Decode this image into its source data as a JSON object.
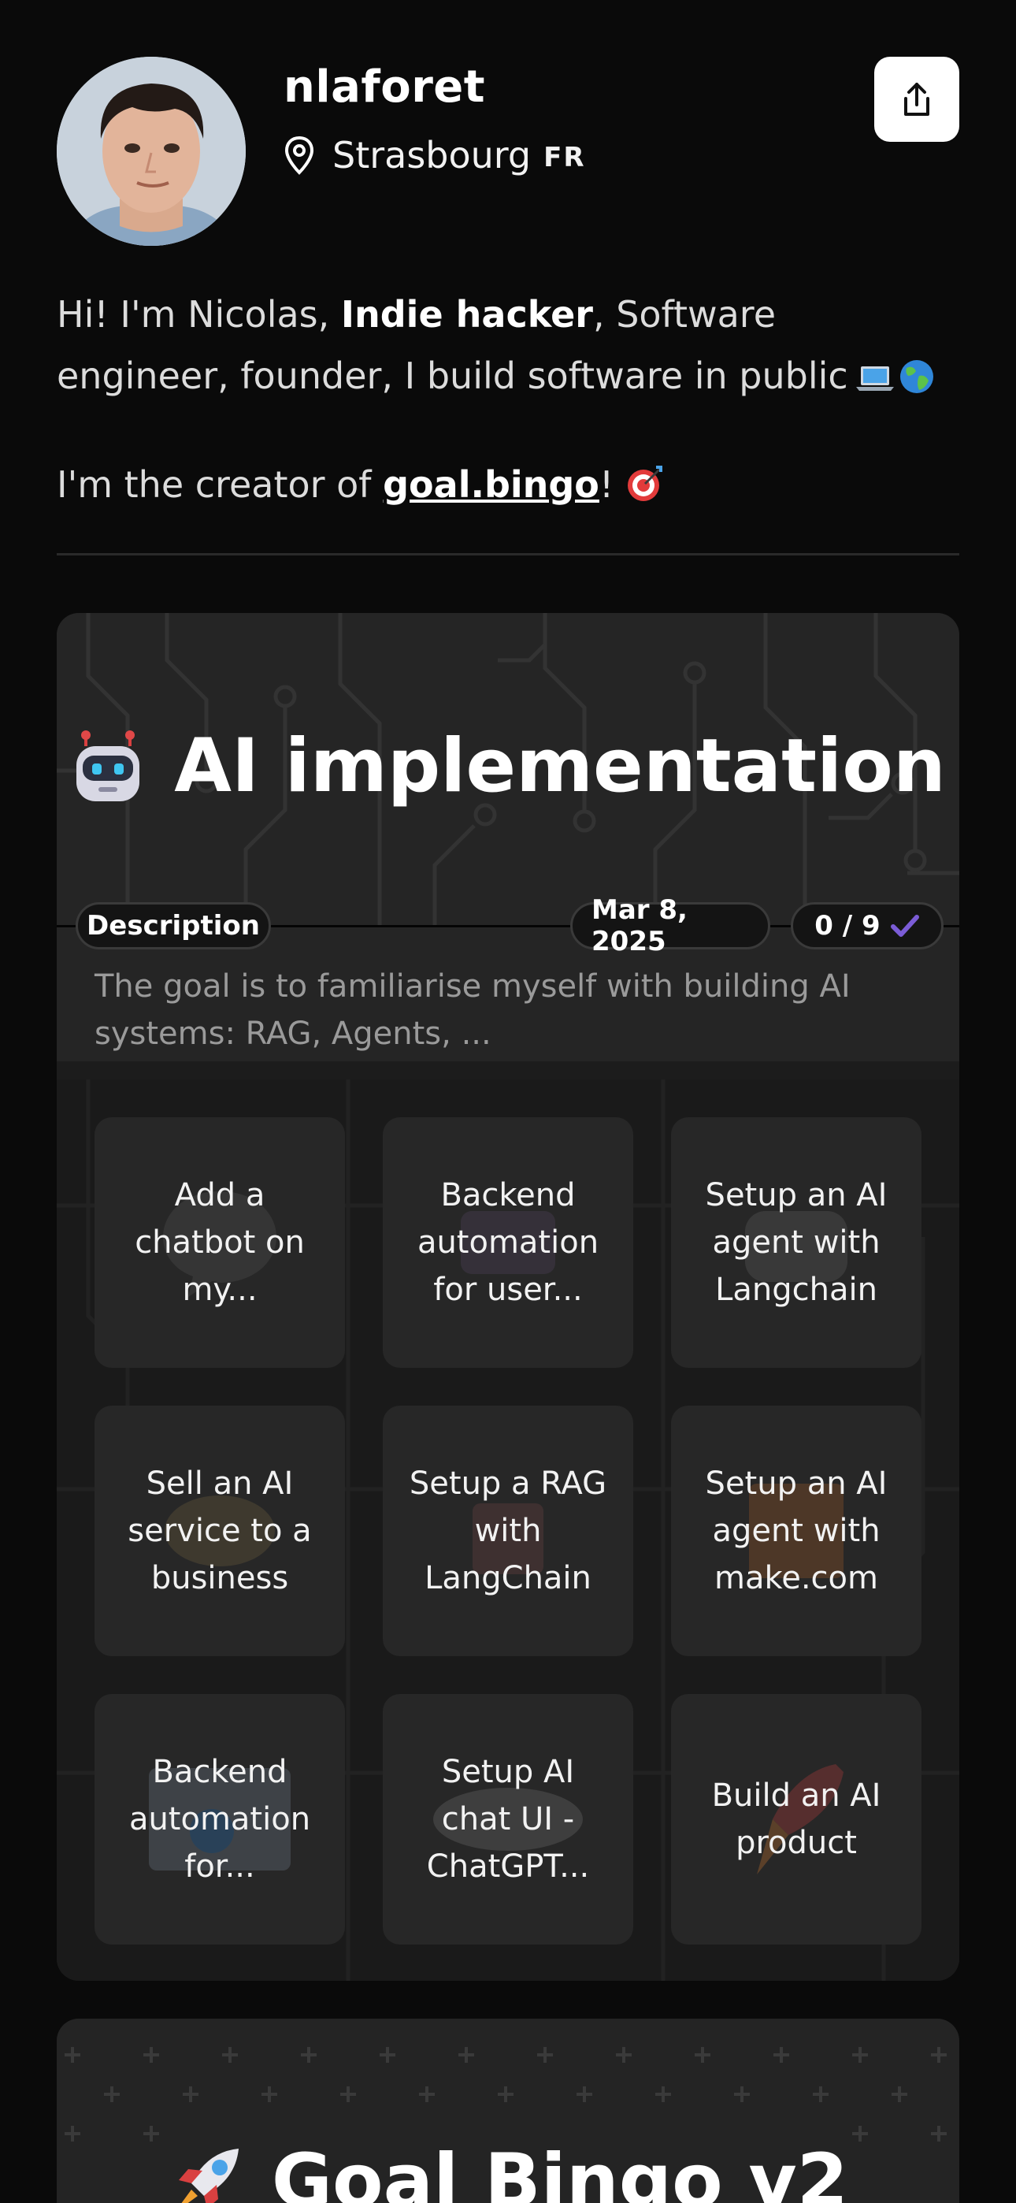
{
  "profile": {
    "username": "nlaforet",
    "city": "Strasbourg",
    "country": "FR"
  },
  "bio": {
    "line1_a": "Hi! I'm Nicolas, ",
    "line1_bold": "Indie hacker",
    "line1_b": ", Software engineer, founder, I build software in public",
    "line2_a": "I'm the creator of ",
    "line2_link": "goal.bingo",
    "line2_b": "!"
  },
  "cards": [
    {
      "title": "AI implementation",
      "description_label": "Description",
      "date": "Mar 8, 2025",
      "progress": "0 / 9",
      "description": "The goal is to familiarise myself with building AI systems: RAG, Agents, ...",
      "tiles": [
        "Add a chatbot on my...",
        "Backend automation for user...",
        "Setup an AI agent with Langchain",
        "Sell an AI service to a business",
        "Setup a RAG with LangChain",
        "Setup an AI agent with make.com",
        "Backend automation for...",
        "Setup AI chat UI - ChatGPT...",
        "Build an AI product"
      ]
    },
    {
      "title": "Goal Bingo v2"
    }
  ],
  "icons": {
    "share": "share-icon",
    "location": "location-pin-icon",
    "check": "check-icon",
    "robot": "robot-emoji",
    "rocket": "rocket-emoji"
  },
  "colors": {
    "background": "#0a0a0a",
    "card": "#1c1c1c",
    "tile": "#272727",
    "check": "#7b5cd6"
  }
}
